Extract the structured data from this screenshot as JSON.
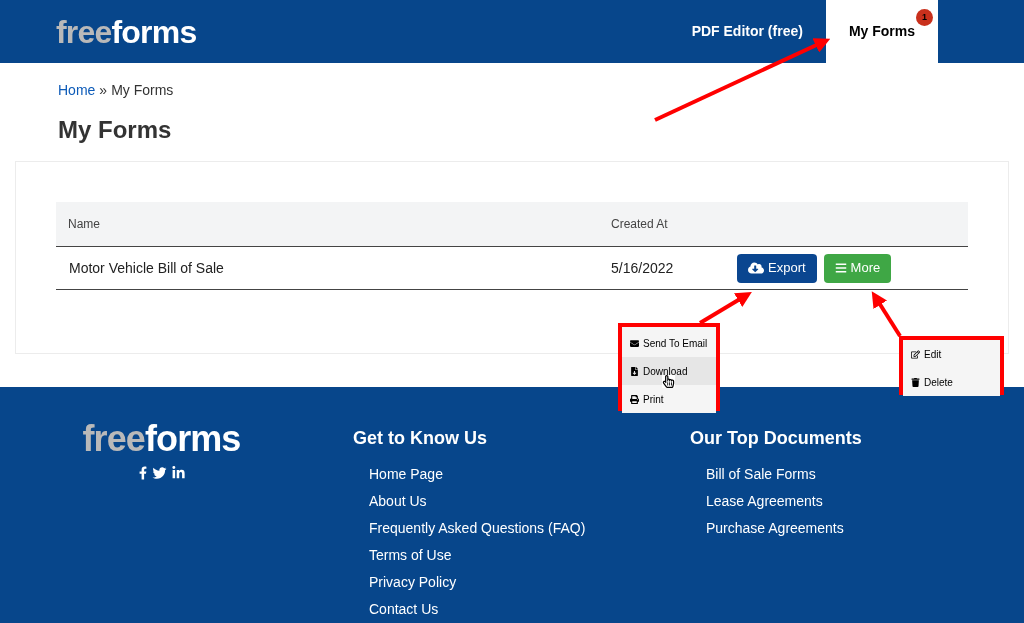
{
  "header": {
    "logo_muted": "free",
    "logo_main": "forms",
    "nav": [
      {
        "label": "PDF Editor (free)",
        "selected": false
      },
      {
        "label": "My Forms",
        "selected": true,
        "badge": "1"
      }
    ]
  },
  "breadcrumb": {
    "home": "Home",
    "separator": "»",
    "current": "My Forms"
  },
  "page_title": "My Forms",
  "table": {
    "columns": [
      "Name",
      "Created At"
    ],
    "rows": [
      {
        "name": "Motor Vehicle Bill of Sale",
        "created_at": "5/16/2022",
        "export_label": "Export",
        "more_label": "More"
      }
    ]
  },
  "export_menu": [
    {
      "kind": "email",
      "label": "Send To Email",
      "highlighted": false
    },
    {
      "kind": "download",
      "label": "Download",
      "highlighted": true
    },
    {
      "kind": "print",
      "label": "Print",
      "highlighted": false
    }
  ],
  "more_menu": [
    {
      "kind": "edit",
      "label": "Edit"
    },
    {
      "kind": "delete",
      "label": "Delete"
    }
  ],
  "footer": {
    "logo_muted": "free",
    "logo_main": "forms",
    "columns": [
      {
        "heading": "Get to Know Us",
        "links": [
          "Home Page",
          "About Us",
          "Frequently Asked Questions (FAQ)",
          "Terms of Use",
          "Privacy Policy",
          "Contact Us"
        ]
      },
      {
        "heading": "Our Top Documents",
        "links": [
          "Bill of Sale Forms",
          "Lease Agreements",
          "Purchase Agreements"
        ]
      }
    ]
  }
}
